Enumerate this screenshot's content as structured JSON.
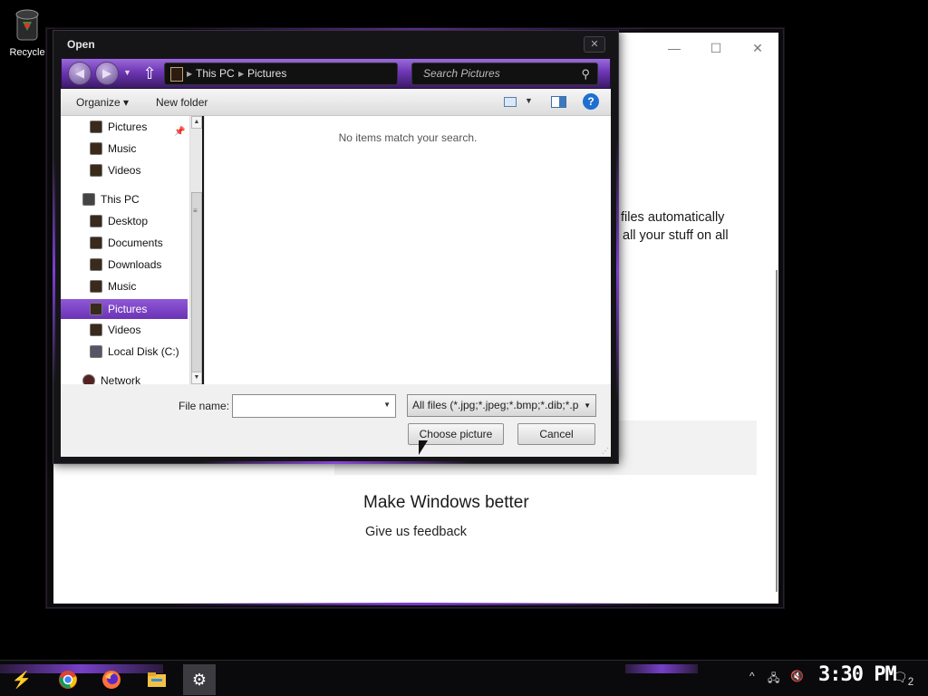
{
  "desktop": {
    "recycle_label": "Recycle"
  },
  "settings_window": {
    "text_line1": "files automatically",
    "text_line2": "all your stuff on all",
    "heading": "Make Windows better",
    "feedback_link": "Give us feedback",
    "minimize_glyph": "—",
    "maximize_glyph": "☐",
    "close_glyph": "✕"
  },
  "dialog": {
    "title": "Open",
    "close_glyph": "✕",
    "address": {
      "segments": [
        "This PC",
        "Pictures"
      ]
    },
    "search_placeholder": "Search Pictures",
    "toolbar": {
      "organize": "Organize ▾",
      "new_folder": "New folder",
      "help": "?"
    },
    "nav_items": [
      {
        "label": "Pictures",
        "indent": 2,
        "pinned": true,
        "selected": false
      },
      {
        "label": "Music",
        "indent": 2,
        "selected": false
      },
      {
        "label": "Videos",
        "indent": 2,
        "selected": false
      },
      {
        "label": "This PC",
        "indent": 1,
        "selected": false
      },
      {
        "label": "Desktop",
        "indent": 2,
        "selected": false
      },
      {
        "label": "Documents",
        "indent": 2,
        "selected": false
      },
      {
        "label": "Downloads",
        "indent": 2,
        "selected": false
      },
      {
        "label": "Music",
        "indent": 2,
        "selected": false
      },
      {
        "label": "Pictures",
        "indent": 2,
        "selected": true
      },
      {
        "label": "Videos",
        "indent": 2,
        "selected": false
      },
      {
        "label": "Local Disk (C:)",
        "indent": 2,
        "selected": false
      },
      {
        "label": "Network",
        "indent": 1,
        "selected": false
      }
    ],
    "empty_message": "No items match your search.",
    "file_name_label": "File name:",
    "file_name_value": "",
    "filter_value": "All files (*.jpg;*.jpeg;*.bmp;*.dib;*.p",
    "choose_button": "Choose picture",
    "cancel_button": "Cancel"
  },
  "taskbar": {
    "apps": [
      {
        "name": "start-button",
        "glyph": "⚡"
      },
      {
        "name": "chrome",
        "glyph": "●"
      },
      {
        "name": "firefox",
        "glyph": "●"
      },
      {
        "name": "file-explorer",
        "glyph": "▬"
      },
      {
        "name": "settings",
        "glyph": "⚙"
      }
    ],
    "clock": "3:30 PM",
    "notification_count": "2",
    "colors": {
      "accent": "#7740c8",
      "selection": "#7b45c6"
    }
  }
}
